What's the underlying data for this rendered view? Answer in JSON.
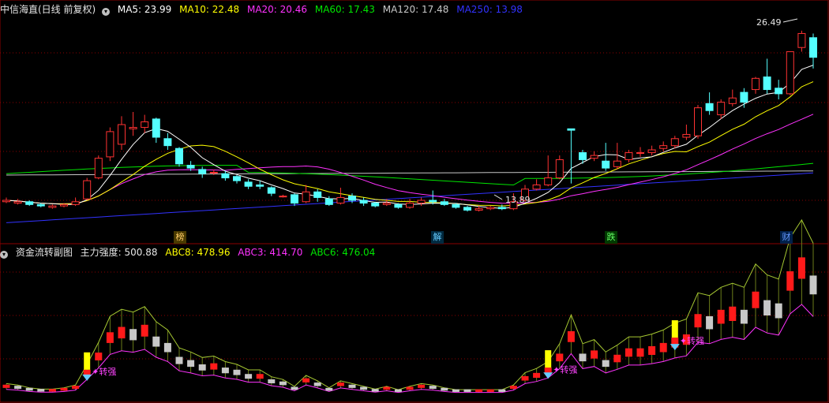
{
  "main_header": {
    "stock": "中信海直(日线 前复权)",
    "ma5": "MA5: 23.99",
    "ma10": "MA10: 22.48",
    "ma20": "MA20: 20.46",
    "ma60": "MA60: 17.43",
    "ma120": "MA120: 17.48",
    "ma250": "MA250: 13.98"
  },
  "sub_header": {
    "title": "资金流转副图",
    "strength": "主力强度: 500.88",
    "abc8": "ABC8: 478.96",
    "abc3": "ABC3: 414.70",
    "abc6": "ABC6: 476.04"
  },
  "annotations": {
    "high": "26.49",
    "low": "13.89",
    "signal_1": "转强",
    "signal_2": "转强",
    "signal_3": "转强"
  },
  "events": [
    "榜",
    "解",
    "跌",
    "财"
  ],
  "colors": {
    "up": "#ff3232",
    "down": "#54ffff",
    "ma5": "#ffffff",
    "ma10": "#ffff00",
    "ma20": "#ff32ff",
    "ma60": "#00e600",
    "ma120": "#c8c8c8",
    "ma250": "#3232ff",
    "grid": "#8b0000",
    "signal": "#ff44ff"
  },
  "chart_data": {
    "type": "candlestick",
    "series": [
      {
        "name": "中信海直",
        "ohlc": [
          [
            14.3,
            14.4,
            14.2,
            14.6
          ],
          [
            14.2,
            14.3,
            14.1,
            14.5
          ],
          [
            14.3,
            14.1,
            14.0,
            14.4
          ],
          [
            14.1,
            14.0,
            13.9,
            14.2
          ],
          [
            13.9,
            14.0,
            13.8,
            14.1
          ],
          [
            14.0,
            14.1,
            13.9,
            14.2
          ],
          [
            14.1,
            14.3,
            14.0,
            14.6
          ],
          [
            14.5,
            15.8,
            14.4,
            16.0
          ],
          [
            16.0,
            17.4,
            15.9,
            17.6
          ],
          [
            17.5,
            19.3,
            17.2,
            19.6
          ],
          [
            18.4,
            19.8,
            18.0,
            20.4
          ],
          [
            19.5,
            19.6,
            19.0,
            20.7
          ],
          [
            19.6,
            20.0,
            19.2,
            20.5
          ],
          [
            20.2,
            18.9,
            18.5,
            20.3
          ],
          [
            18.8,
            18.3,
            18.0,
            19.2
          ],
          [
            18.1,
            17.0,
            16.8,
            18.2
          ],
          [
            16.9,
            16.7,
            16.5,
            17.2
          ],
          [
            16.6,
            16.3,
            16.0,
            16.8
          ],
          [
            16.4,
            16.4,
            16.2,
            16.6
          ],
          [
            16.3,
            16.0,
            15.8,
            16.5
          ],
          [
            16.1,
            15.8,
            15.6,
            16.2
          ],
          [
            15.7,
            15.4,
            15.2,
            15.9
          ],
          [
            15.5,
            15.4,
            15.2,
            15.8
          ],
          [
            15.3,
            14.9,
            14.7,
            15.4
          ],
          [
            14.7,
            14.7,
            14.6,
            14.8
          ],
          [
            14.8,
            14.2,
            14.0,
            14.9
          ],
          [
            14.3,
            15.0,
            14.2,
            15.5
          ],
          [
            15.0,
            14.6,
            14.3,
            15.2
          ],
          [
            14.5,
            14.1,
            14.0,
            14.7
          ],
          [
            14.2,
            14.6,
            14.1,
            15.3
          ],
          [
            14.7,
            14.4,
            14.2,
            14.9
          ],
          [
            14.4,
            14.2,
            14.0,
            14.6
          ],
          [
            14.2,
            14.0,
            13.9,
            14.3
          ],
          [
            14.1,
            14.2,
            14.0,
            14.5
          ],
          [
            14.1,
            13.9,
            13.8,
            14.2
          ],
          [
            13.9,
            14.2,
            13.8,
            14.5
          ],
          [
            14.2,
            14.4,
            14.0,
            14.6
          ],
          [
            14.4,
            14.3,
            14.1,
            15.1
          ],
          [
            14.3,
            14.1,
            14.0,
            14.5
          ],
          [
            14.1,
            13.9,
            13.8,
            14.2
          ],
          [
            13.9,
            13.7,
            13.6,
            14.0
          ],
          [
            13.7,
            13.8,
            13.6,
            14.0
          ],
          [
            13.8,
            13.9,
            13.7,
            14.0
          ],
          [
            13.9,
            13.8,
            13.7,
            14.1
          ],
          [
            13.8,
            14.3,
            13.7,
            14.9
          ],
          [
            14.4,
            15.2,
            14.3,
            15.5
          ],
          [
            15.2,
            15.5,
            15.1,
            15.9
          ],
          [
            15.5,
            16.0,
            15.4,
            17.6
          ],
          [
            16.0,
            17.3,
            15.9,
            17.6
          ],
          [
            19.5,
            19.4,
            15.6,
            19.5
          ],
          [
            17.8,
            17.3,
            17.0,
            18.0
          ],
          [
            17.4,
            17.6,
            17.2,
            17.9
          ],
          [
            17.2,
            16.7,
            16.5,
            18.5
          ],
          [
            16.8,
            17.2,
            16.6,
            18.5
          ],
          [
            17.3,
            17.8,
            17.1,
            18.0
          ],
          [
            17.8,
            17.8,
            17.5,
            18.2
          ],
          [
            17.8,
            18.0,
            17.6,
            18.3
          ],
          [
            18.1,
            18.3,
            17.9,
            18.6
          ],
          [
            18.3,
            18.8,
            18.1,
            19.0
          ],
          [
            18.9,
            19.1,
            18.7,
            19.8
          ],
          [
            19.0,
            21.0,
            18.8,
            21.2
          ],
          [
            21.3,
            20.8,
            20.5,
            22.1
          ],
          [
            20.5,
            21.4,
            20.2,
            21.6
          ],
          [
            21.3,
            21.7,
            21.1,
            22.3
          ],
          [
            22.1,
            21.4,
            21.0,
            22.4
          ],
          [
            22.3,
            23.1,
            22.0,
            23.2
          ],
          [
            23.2,
            22.3,
            22.0,
            24.5
          ],
          [
            22.4,
            22.0,
            21.6,
            23.0
          ],
          [
            22.0,
            25.0,
            21.9,
            25.0
          ],
          [
            25.3,
            26.3,
            25.0,
            26.5
          ],
          [
            26.0,
            24.6,
            23.8,
            26.3
          ]
        ]
      }
    ],
    "ma_labels": [
      "MA5",
      "MA10",
      "MA20",
      "MA60",
      "MA120",
      "MA250"
    ]
  }
}
